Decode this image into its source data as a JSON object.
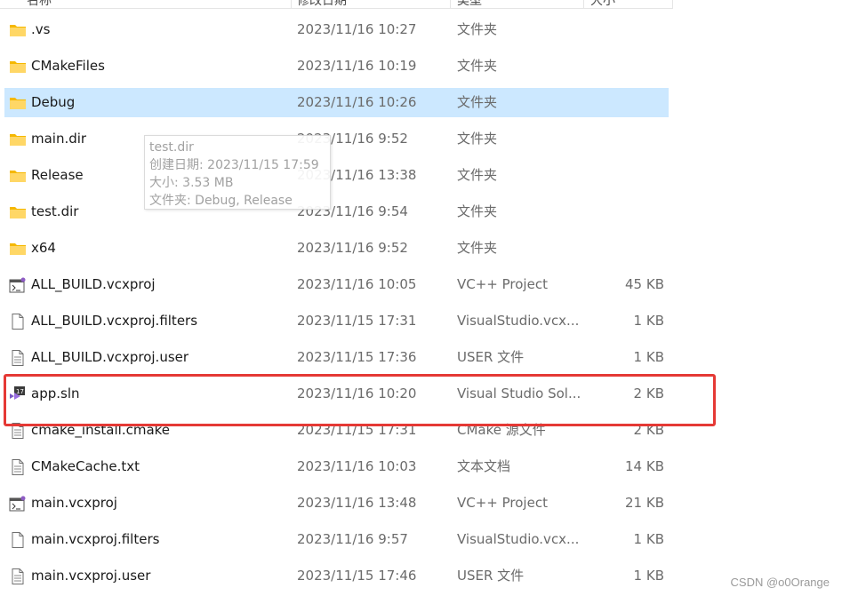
{
  "header": {
    "columns": [
      "名称",
      "修改日期",
      "类型",
      "大小"
    ]
  },
  "files": [
    {
      "name": ".vs",
      "date": "2023/11/16 10:27",
      "type": "文件夹",
      "size": "",
      "icon": "folder-icon"
    },
    {
      "name": "CMakeFiles",
      "date": "2023/11/16 10:19",
      "type": "文件夹",
      "size": "",
      "icon": "folder-icon"
    },
    {
      "name": "Debug",
      "date": "2023/11/16 10:26",
      "type": "文件夹",
      "size": "",
      "icon": "folder-icon",
      "selected": true
    },
    {
      "name": "main.dir",
      "date": "2023/11/16 9:52",
      "type": "文件夹",
      "size": "",
      "icon": "folder-icon"
    },
    {
      "name": "Release",
      "date": "2023/11/16 13:38",
      "type": "文件夹",
      "size": "",
      "icon": "folder-icon"
    },
    {
      "name": "test.dir",
      "date": "2023/11/16 9:54",
      "type": "文件夹",
      "size": "",
      "icon": "folder-icon"
    },
    {
      "name": "x64",
      "date": "2023/11/16 9:52",
      "type": "文件夹",
      "size": "",
      "icon": "folder-icon"
    },
    {
      "name": "ALL_BUILD.vcxproj",
      "date": "2023/11/16 10:05",
      "type": "VC++ Project",
      "size": "45 KB",
      "icon": "vcxproj-icon"
    },
    {
      "name": "ALL_BUILD.vcxproj.filters",
      "date": "2023/11/15 17:31",
      "type": "VisualStudio.vcx...",
      "size": "1 KB",
      "icon": "blank-file-icon"
    },
    {
      "name": "ALL_BUILD.vcxproj.user",
      "date": "2023/11/15 17:36",
      "type": "USER 文件",
      "size": "1 KB",
      "icon": "text-file-icon"
    },
    {
      "name": "app.sln",
      "date": "2023/11/16 10:20",
      "type": "Visual Studio Sol...",
      "size": "2 KB",
      "icon": "sln-icon"
    },
    {
      "name": "cmake_install.cmake",
      "date": "2023/11/15 17:31",
      "type": "CMake 源文件",
      "size": "2 KB",
      "icon": "text-file-icon"
    },
    {
      "name": "CMakeCache.txt",
      "date": "2023/11/16 10:03",
      "type": "文本文档",
      "size": "14 KB",
      "icon": "text-file-icon"
    },
    {
      "name": "main.vcxproj",
      "date": "2023/11/16 13:48",
      "type": "VC++ Project",
      "size": "21 KB",
      "icon": "vcxproj-icon"
    },
    {
      "name": "main.vcxproj.filters",
      "date": "2023/11/16 9:57",
      "type": "VisualStudio.vcx...",
      "size": "1 KB",
      "icon": "blank-file-icon"
    },
    {
      "name": "main.vcxproj.user",
      "date": "2023/11/15 17:46",
      "type": "USER 文件",
      "size": "1 KB",
      "icon": "text-file-icon"
    }
  ],
  "tooltip": {
    "title": "test.dir",
    "created": "创建日期: 2023/11/15 17:59",
    "size": "大小: 3.53 MB",
    "contents": "文件夹: Debug, Release"
  },
  "watermark": "CSDN @o0Orange",
  "colors": {
    "selection": "#cce8ff",
    "folder": "#ffc83d",
    "highlight_box": "#e53935"
  }
}
